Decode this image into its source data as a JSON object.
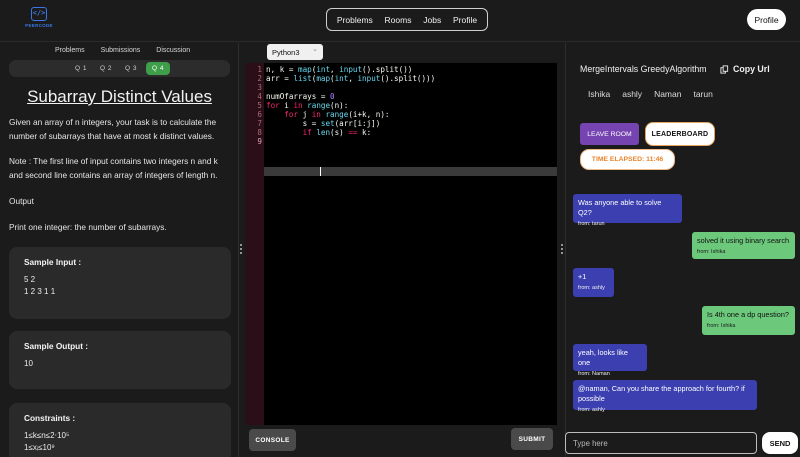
{
  "brand": {
    "logo_glyph": "</>",
    "name": "PEERCODE",
    "accent": "#3a78e8"
  },
  "nav": {
    "items": [
      "Problems",
      "Rooms",
      "Jobs",
      "Profile"
    ],
    "profile_button": "Profile"
  },
  "problem": {
    "tabs": [
      "Problems",
      "Submissions",
      "Discussion"
    ],
    "questions": [
      "Q 1",
      "Q 2",
      "Q 3",
      "Q 4"
    ],
    "active_question": "Q 4",
    "title": "Subarray Distinct Values",
    "description": "Given an array of n integers, your task is to calculate the number of subarrays that have at most k distinct values.",
    "note": "Note : The first line of input contains two integers n and k and second line contains an array of integers of length n.",
    "output_heading": "Output",
    "output_text": "Print one integer: the number of subarrays.",
    "sample_input_title": "Sample Input :",
    "sample_input_lines": [
      "5 2",
      "1 2 3 1 1"
    ],
    "sample_output_title": "Sample Output :",
    "sample_output": "10",
    "constraints_title": "Constraints :",
    "constraints": [
      "1≤k≤n≤2⋅10⁵",
      "1≤xᵢ≤10⁹"
    ]
  },
  "editor": {
    "language": "Python3",
    "line_numbers": [
      "1",
      "2",
      "3",
      "4",
      "5",
      "6",
      "7",
      "8",
      "9"
    ],
    "console_label": "CONSOLE",
    "submit_label": "SUBMIT"
  },
  "room": {
    "name": "MergeIntervals GreedyAlgorithm",
    "copy_url_label": "Copy Url",
    "members": [
      "Ishika",
      "ashly",
      "Naman",
      "tarun"
    ],
    "leave_label": "LEAVE ROOM",
    "leaderboard_label": "LEADERBOARD",
    "time_elapsed": "TIME ELAPSED: 11:46",
    "messages": [
      {
        "text": "Was anyone able to solve Q2?",
        "from": "from: tarun",
        "side": "them"
      },
      {
        "text": "solved it using binary search",
        "from": "from: Ishika",
        "side": "me"
      },
      {
        "text": "+1",
        "from": "from: ashly",
        "side": "them"
      },
      {
        "text": "Is 4th one a dp question?",
        "from": "from: Ishika",
        "side": "me"
      },
      {
        "text": "yeah, looks like one",
        "from": "from: Naman",
        "side": "them"
      },
      {
        "text": "@naman, Can you share the approach for fourth? if possible",
        "from": "from: ashly",
        "side": "them"
      }
    ],
    "input_placeholder": "Type here",
    "send_label": "SEND"
  }
}
